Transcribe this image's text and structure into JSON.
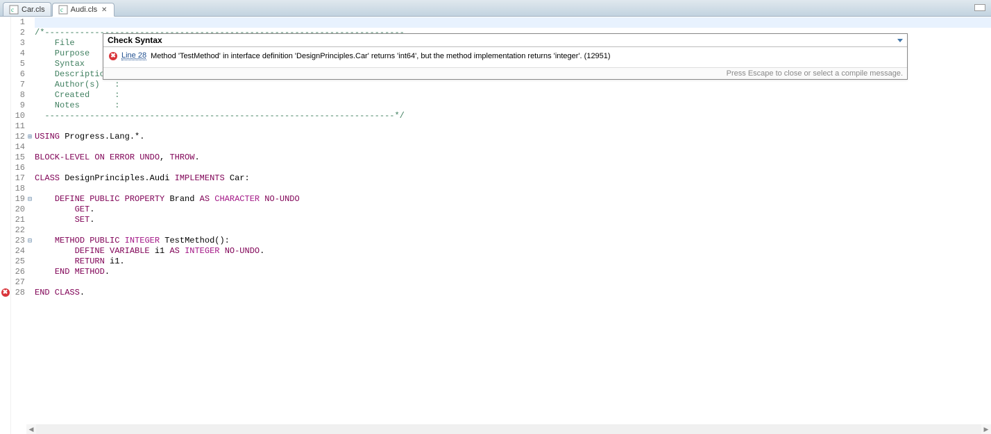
{
  "tabs": [
    {
      "label": "Car.cls",
      "active": false
    },
    {
      "label": "Audi.cls",
      "active": true
    }
  ],
  "syntax_panel": {
    "title": "Check Syntax",
    "line_link": "Line 28",
    "message": "Method 'TestMethod' in interface definition 'DesignPrinciples.Car' returns 'int64', but the method implementation returns 'integer'. (12951)",
    "footer": "Press Escape to close or select a compile message."
  },
  "folds": {
    "12": "plus",
    "19": "minus",
    "23": "minus"
  },
  "gutter": {
    "28": "error"
  },
  "highlight_line": 1,
  "lines": [
    {
      "n": 1,
      "tokens": []
    },
    {
      "n": 2,
      "tokens": [
        {
          "c": "c-comment",
          "t": "/*------------------------------------------------------------------------"
        }
      ]
    },
    {
      "n": 3,
      "tokens": [
        {
          "c": "c-comment",
          "t": "    File        : "
        }
      ]
    },
    {
      "n": 4,
      "tokens": [
        {
          "c": "c-comment",
          "t": "    Purpose     : "
        }
      ]
    },
    {
      "n": 5,
      "tokens": [
        {
          "c": "c-comment",
          "t": "    Syntax      : "
        }
      ]
    },
    {
      "n": 6,
      "tokens": [
        {
          "c": "c-comment",
          "t": "    Description : "
        }
      ]
    },
    {
      "n": 7,
      "tokens": [
        {
          "c": "c-comment",
          "t": "    Author(s)   : "
        }
      ]
    },
    {
      "n": 8,
      "tokens": [
        {
          "c": "c-comment",
          "t": "    Created     : "
        }
      ]
    },
    {
      "n": 9,
      "tokens": [
        {
          "c": "c-comment",
          "t": "    Notes       : "
        }
      ]
    },
    {
      "n": 10,
      "tokens": [
        {
          "c": "c-comment",
          "t": "  ----------------------------------------------------------------------*/"
        }
      ]
    },
    {
      "n": 11,
      "tokens": []
    },
    {
      "n": 12,
      "tokens": [
        {
          "c": "c-kw",
          "t": "USING"
        },
        {
          "c": "c-plain",
          "t": " Progress.Lang.*."
        }
      ]
    },
    {
      "n": 14,
      "tokens": []
    },
    {
      "n": 15,
      "tokens": [
        {
          "c": "c-kw",
          "t": "BLOCK-LEVEL ON ERROR UNDO"
        },
        {
          "c": "c-plain",
          "t": ", "
        },
        {
          "c": "c-kw",
          "t": "THROW"
        },
        {
          "c": "c-plain",
          "t": "."
        }
      ]
    },
    {
      "n": 16,
      "tokens": []
    },
    {
      "n": 17,
      "tokens": [
        {
          "c": "c-kw",
          "t": "CLASS"
        },
        {
          "c": "c-plain",
          "t": " DesignPrinciples.Audi "
        },
        {
          "c": "c-kw",
          "t": "IMPLEMENTS"
        },
        {
          "c": "c-plain",
          "t": " Car:"
        }
      ]
    },
    {
      "n": 18,
      "tokens": []
    },
    {
      "n": 19,
      "tokens": [
        {
          "c": "c-plain",
          "t": "    "
        },
        {
          "c": "c-kw",
          "t": "DEFINE PUBLIC PROPERTY"
        },
        {
          "c": "c-plain",
          "t": " Brand "
        },
        {
          "c": "c-kw",
          "t": "AS"
        },
        {
          "c": "c-plain",
          "t": " "
        },
        {
          "c": "c-magenta",
          "t": "CHARACTER"
        },
        {
          "c": "c-plain",
          "t": " "
        },
        {
          "c": "c-kw",
          "t": "NO-UNDO"
        }
      ]
    },
    {
      "n": 20,
      "tokens": [
        {
          "c": "c-plain",
          "t": "        "
        },
        {
          "c": "c-kw",
          "t": "GET"
        },
        {
          "c": "c-plain",
          "t": "."
        }
      ]
    },
    {
      "n": 21,
      "tokens": [
        {
          "c": "c-plain",
          "t": "        "
        },
        {
          "c": "c-kw",
          "t": "SET"
        },
        {
          "c": "c-plain",
          "t": "."
        }
      ]
    },
    {
      "n": 22,
      "tokens": []
    },
    {
      "n": 23,
      "tokens": [
        {
          "c": "c-plain",
          "t": "    "
        },
        {
          "c": "c-kw",
          "t": "METHOD PUBLIC"
        },
        {
          "c": "c-plain",
          "t": " "
        },
        {
          "c": "c-magenta",
          "t": "INTEGER"
        },
        {
          "c": "c-plain",
          "t": " TestMethod():"
        }
      ]
    },
    {
      "n": 24,
      "tokens": [
        {
          "c": "c-plain",
          "t": "        "
        },
        {
          "c": "c-kw",
          "t": "DEFINE VARIABLE"
        },
        {
          "c": "c-plain",
          "t": " i1 "
        },
        {
          "c": "c-kw",
          "t": "AS"
        },
        {
          "c": "c-plain",
          "t": " "
        },
        {
          "c": "c-magenta",
          "t": "INTEGER"
        },
        {
          "c": "c-plain",
          "t": " "
        },
        {
          "c": "c-kw",
          "t": "NO-UNDO"
        },
        {
          "c": "c-plain",
          "t": "."
        }
      ]
    },
    {
      "n": 25,
      "tokens": [
        {
          "c": "c-plain",
          "t": "        "
        },
        {
          "c": "c-kw",
          "t": "RETURN"
        },
        {
          "c": "c-plain",
          "t": " i1."
        }
      ]
    },
    {
      "n": 26,
      "tokens": [
        {
          "c": "c-plain",
          "t": "    "
        },
        {
          "c": "c-kw",
          "t": "END METHOD"
        },
        {
          "c": "c-plain",
          "t": "."
        }
      ]
    },
    {
      "n": 27,
      "tokens": []
    },
    {
      "n": 28,
      "tokens": [
        {
          "c": "c-kw",
          "t": "END CLASS"
        },
        {
          "c": "c-plain",
          "t": "."
        }
      ]
    }
  ]
}
